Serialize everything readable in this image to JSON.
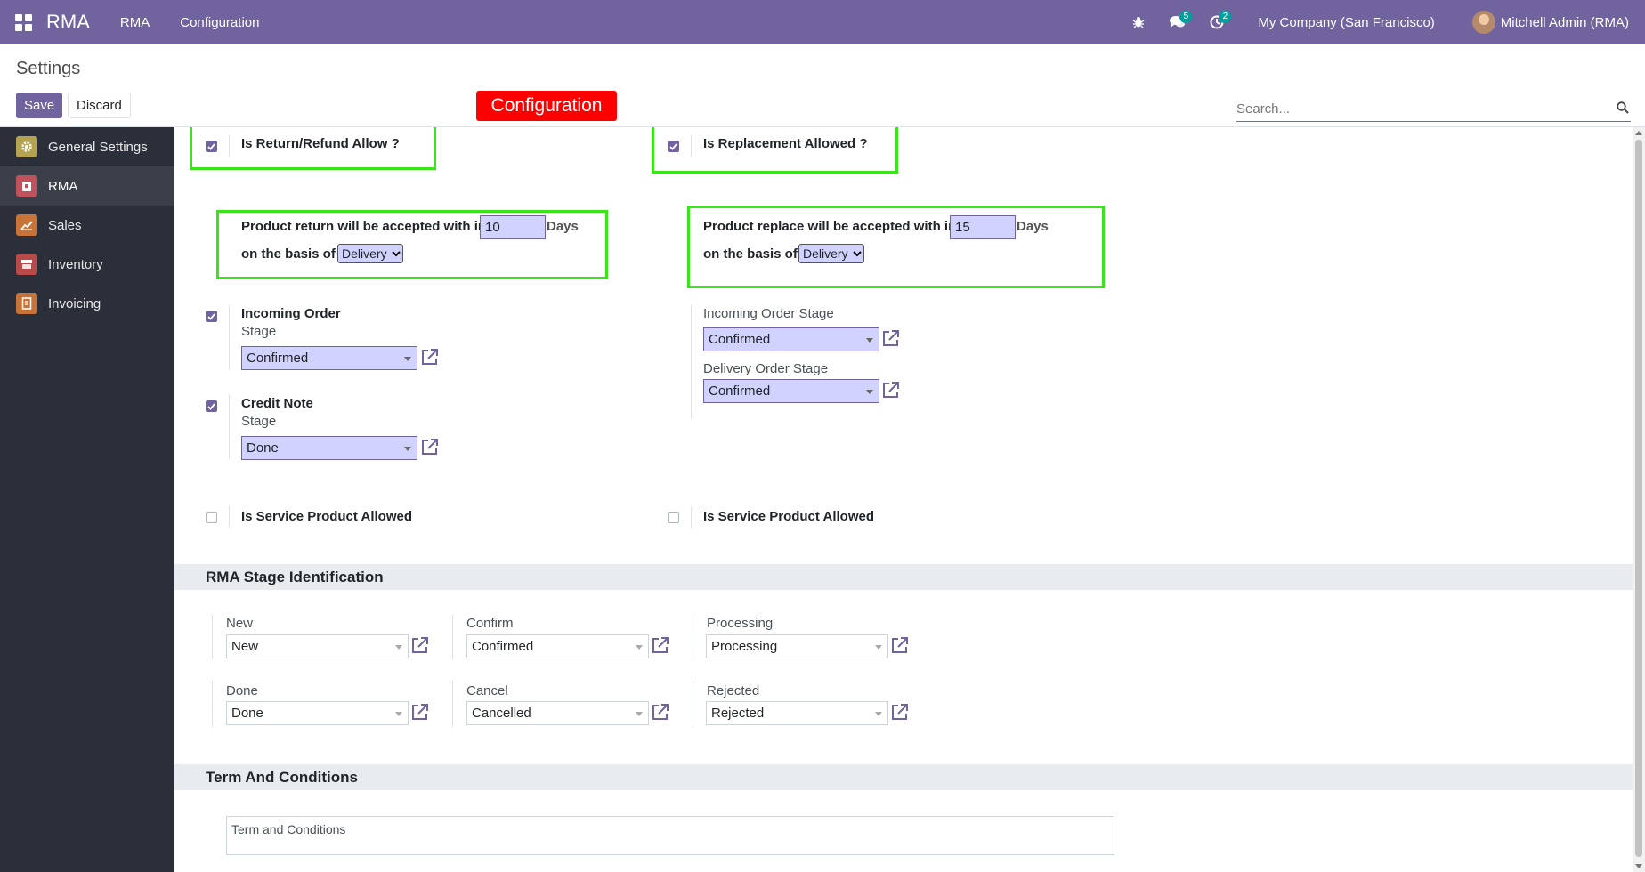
{
  "navbar": {
    "brand": "RMA",
    "menu": [
      "RMA",
      "Configuration"
    ],
    "chat_badge": "5",
    "activity_badge": "2",
    "company": "My Company (San Francisco)",
    "user": "Mitchell Admin (RMA)",
    "color": "#71639e"
  },
  "control": {
    "title": "Settings",
    "save_label": "Save",
    "discard_label": "Discard",
    "search_placeholder": "Search..."
  },
  "annotation": {
    "label": "Configuration"
  },
  "sidebar": {
    "items": [
      {
        "label": "General Settings",
        "color": "#b5a352",
        "icon": "gear-icon"
      },
      {
        "label": "RMA",
        "color": "#c0525d",
        "icon": "rma-icon"
      },
      {
        "label": "Sales",
        "color": "#c87438",
        "icon": "chart-icon"
      },
      {
        "label": "Inventory",
        "color": "#b94a4a",
        "icon": "box-icon"
      },
      {
        "label": "Invoicing",
        "color": "#c87438",
        "icon": "invoice-icon"
      }
    ]
  },
  "settings": {
    "return_allow": {
      "label": "Is Return/Refund Allow ?",
      "checked": true
    },
    "replacement_allow": {
      "label": "Is Replacement Allowed ?",
      "checked": true
    },
    "return_rule": {
      "prefix": "Product return will be accepted with in",
      "days": "10",
      "suffix": "Days",
      "basis_label": "on the basis of",
      "basis_value": "Delivery"
    },
    "replace_rule": {
      "prefix": "Product replace will be accepted with in",
      "days": "15",
      "suffix": "Days",
      "basis_label": "on the basis of",
      "basis_value": "Delivery"
    },
    "incoming_order": {
      "label": "Incoming Order",
      "stage_label": "Stage",
      "stage_value": "Confirmed",
      "checked": true
    },
    "credit_note": {
      "label": "Credit Note",
      "stage_label": "Stage",
      "stage_value": "Done",
      "checked": true
    },
    "replace_incoming": {
      "label": "Incoming Order Stage",
      "value": "Confirmed"
    },
    "replace_delivery": {
      "label": "Delivery Order Stage",
      "value": "Confirmed"
    },
    "service_left": {
      "label": "Is Service Product Allowed",
      "checked": false
    },
    "service_right": {
      "label": "Is Service Product Allowed",
      "checked": false
    }
  },
  "stages": {
    "title": "RMA Stage Identification",
    "items": [
      {
        "label": "New",
        "value": "New"
      },
      {
        "label": "Confirm",
        "value": "Confirmed"
      },
      {
        "label": "Processing",
        "value": "Processing"
      },
      {
        "label": "Done",
        "value": "Done"
      },
      {
        "label": "Cancel",
        "value": "Cancelled"
      },
      {
        "label": "Rejected",
        "value": "Rejected"
      }
    ]
  },
  "terms": {
    "title": "Term And Conditions",
    "placeholder": "Term and Conditions"
  }
}
